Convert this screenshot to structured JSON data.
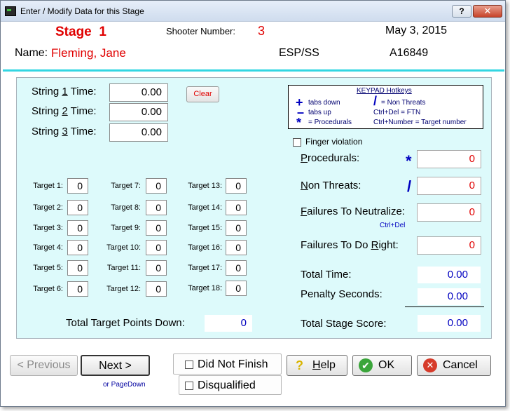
{
  "window": {
    "title": "Enter / Modify Data for this Stage",
    "help_btn": "?",
    "close_btn": "✕"
  },
  "header": {
    "stage_label": "Stage",
    "stage_number": "1",
    "shooter_label": "Shooter Number:",
    "shooter_number": "3",
    "date": "May  3, 2015",
    "name_label": "Name:",
    "name_value": "Fleming, Jane",
    "division": "ESP/SS",
    "id": "A16849"
  },
  "strings": [
    {
      "pre": "String ",
      "num": "1",
      "post": " Time:",
      "value": "0.00"
    },
    {
      "pre": "String ",
      "num": "2",
      "post": " Time:",
      "value": "0.00"
    },
    {
      "pre": "String ",
      "num": "3",
      "post": " Time:",
      "value": "0.00"
    }
  ],
  "clear_label": "Clear",
  "hotkeys": {
    "title": "KEYPAD Hotkeys",
    "plus_sym": "+",
    "plus_text": "tabs down",
    "minus_sym": "–",
    "minus_text": "tabs up",
    "star_sym": "*",
    "star_text": "= Procedurals",
    "slash_sym": "/",
    "slash_text": "= Non Threats",
    "ctrl_del": "Ctrl+Del = FTN",
    "ctrl_num": "Ctrl+Number = Target number"
  },
  "targets": [
    {
      "label": "Target 1:",
      "value": "0"
    },
    {
      "label": "Target 2:",
      "value": "0"
    },
    {
      "label": "Target 3:",
      "value": "0"
    },
    {
      "label": "Target 4:",
      "value": "0"
    },
    {
      "label": "Target 5:",
      "value": "0"
    },
    {
      "label": "Target 6:",
      "value": "0"
    },
    {
      "label": "Target 7:",
      "value": "0"
    },
    {
      "label": "Target 8:",
      "value": "0"
    },
    {
      "label": "Target 9:",
      "value": "0"
    },
    {
      "label": "Target 10:",
      "value": "0"
    },
    {
      "label": "Target 11:",
      "value": "0"
    },
    {
      "label": "Target 12:",
      "value": "0"
    },
    {
      "label": "Target 13:",
      "value": "0"
    },
    {
      "label": "Target 14:",
      "value": "0"
    },
    {
      "label": "Target 15:",
      "value": "0"
    },
    {
      "label": "Target 16:",
      "value": "0"
    },
    {
      "label": "Target 17:",
      "value": "0"
    },
    {
      "label": "Target 18:",
      "value": "0"
    }
  ],
  "total_points": {
    "label": "Total Target Points Down:",
    "value": "0"
  },
  "finger_violation": "Finger violation",
  "procedurals": {
    "label_u": "P",
    "label_rest": "rocedurals:",
    "sym": "*",
    "value": "0"
  },
  "non_threats": {
    "label_u": "N",
    "label_rest": "on Threats:",
    "sym": "/",
    "value": "0"
  },
  "ftn": {
    "label_u": "F",
    "label_rest": "ailures To Neutralize:",
    "hint": "Ctrl+Del",
    "value": "0"
  },
  "ftdr": {
    "label_pre": "Failures To Do ",
    "label_u": "R",
    "label_rest": "ight:",
    "value": "0"
  },
  "total_time": {
    "label": "Total Time:",
    "value": "0.00"
  },
  "penalty": {
    "label": "Penalty Seconds:",
    "value": "0.00"
  },
  "stage_score": {
    "label": "Total Stage Score:",
    "value": "0.00"
  },
  "buttons": {
    "previous": "< Previous",
    "next": "Next >",
    "next_hint": "or PageDown",
    "dnf": "Did Not Finish",
    "dq": "Disqualified",
    "help": "Help",
    "help_u": "H",
    "help_rest": "elp",
    "ok": "OK",
    "cancel": "Cancel"
  },
  "colors": {
    "accent_red": "#e00000",
    "value_blue": "#0000c0",
    "panel_bg": "#ddfafb",
    "divider_cyan": "#33d6e2"
  }
}
